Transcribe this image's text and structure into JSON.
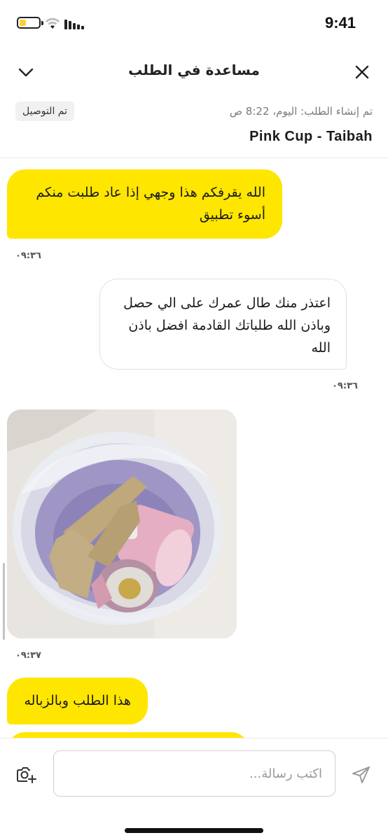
{
  "status_bar": {
    "time": "9:41",
    "battery_color": "#f7d433"
  },
  "header": {
    "title": "مساعدة في الطلب",
    "left_icon": "chevron-down-icon",
    "right_icon": "close-icon"
  },
  "order": {
    "status_badge": "تم التوصيل",
    "created_at": "تم إنشاء الطلب: اليوم، 8:22 ص",
    "store_name": "Pink Cup - Taibah"
  },
  "messages": [
    {
      "side": "customer",
      "text": "الله يقرفكم هذا وجهي إذا عاد طلبت منكم أسوء تطبيق",
      "time": "٠٩:٣٦"
    },
    {
      "side": "support",
      "text": "اعتذر منك طال عمرك على الي حصل وباذن الله طلباتك القادمة افضل باذن الله",
      "time": "٠٩:٣٦"
    },
    {
      "side": "customer",
      "type": "image",
      "image_desc": "photo",
      "time": "٠٩:٣٧"
    },
    {
      "side": "customer",
      "text": "هذا الطلب وبالزباله"
    }
  ],
  "composer": {
    "placeholder": "اكتب رسالة...",
    "camera_icon": "camera-plus-icon",
    "send_icon": "send-icon"
  },
  "colors": {
    "accent_yellow": "#ffe600",
    "support_border": "#e2e2e2"
  }
}
